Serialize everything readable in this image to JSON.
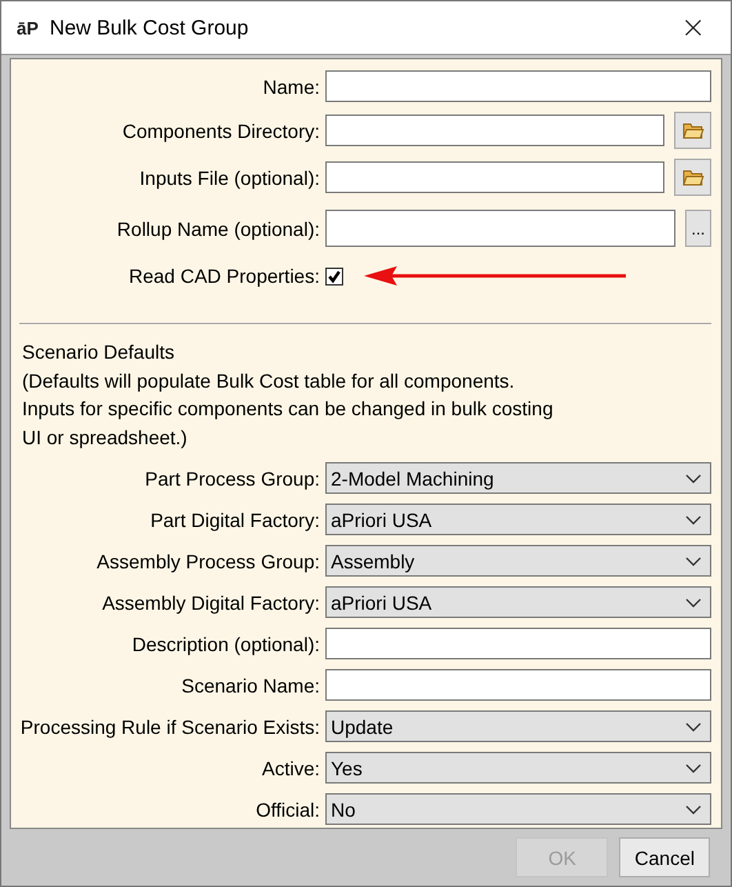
{
  "window": {
    "title": "New Bulk Cost Group",
    "logo": "āP",
    "close": "×"
  },
  "fields": [
    {
      "kind": "text",
      "label": "Name:"
    },
    {
      "kind": "browse",
      "label": "Components Directory:"
    },
    {
      "kind": "browse",
      "label": "Inputs File (optional):"
    },
    {
      "kind": "ellipsis",
      "label": "Rollup Name (optional):",
      "button": "..."
    },
    {
      "kind": "checkbox",
      "label": "Read CAD Properties:",
      "checked": true,
      "highlighted": true
    }
  ],
  "scenario_defaults": {
    "title": "Scenario Defaults",
    "note": "(Defaults will populate Bulk Cost table for all components.\nInputs for specific components can be changed in bulk costing\nUI or spreadsheet.)"
  },
  "scenario_fields": [
    {
      "kind": "select",
      "label": "Part Process Group:",
      "value": "2-Model Machining"
    },
    {
      "kind": "select",
      "label": "Part Digital Factory:",
      "value": "aPriori USA"
    },
    {
      "kind": "select",
      "label": "Assembly Process Group:",
      "value": "Assembly"
    },
    {
      "kind": "select",
      "label": "Assembly Digital Factory:",
      "value": "aPriori USA"
    },
    {
      "kind": "text",
      "label": "Description (optional):"
    },
    {
      "kind": "text",
      "label": "Scenario Name:"
    },
    {
      "kind": "select",
      "label": "Processing Rule if Scenario Exists:",
      "value": "Update"
    },
    {
      "kind": "select",
      "label": "Active:",
      "value": "Yes"
    },
    {
      "kind": "select",
      "label": "Official:",
      "value": "No"
    }
  ],
  "buttons": [
    {
      "label": "OK",
      "disabled": true
    },
    {
      "label": "Cancel",
      "disabled": false
    }
  ]
}
